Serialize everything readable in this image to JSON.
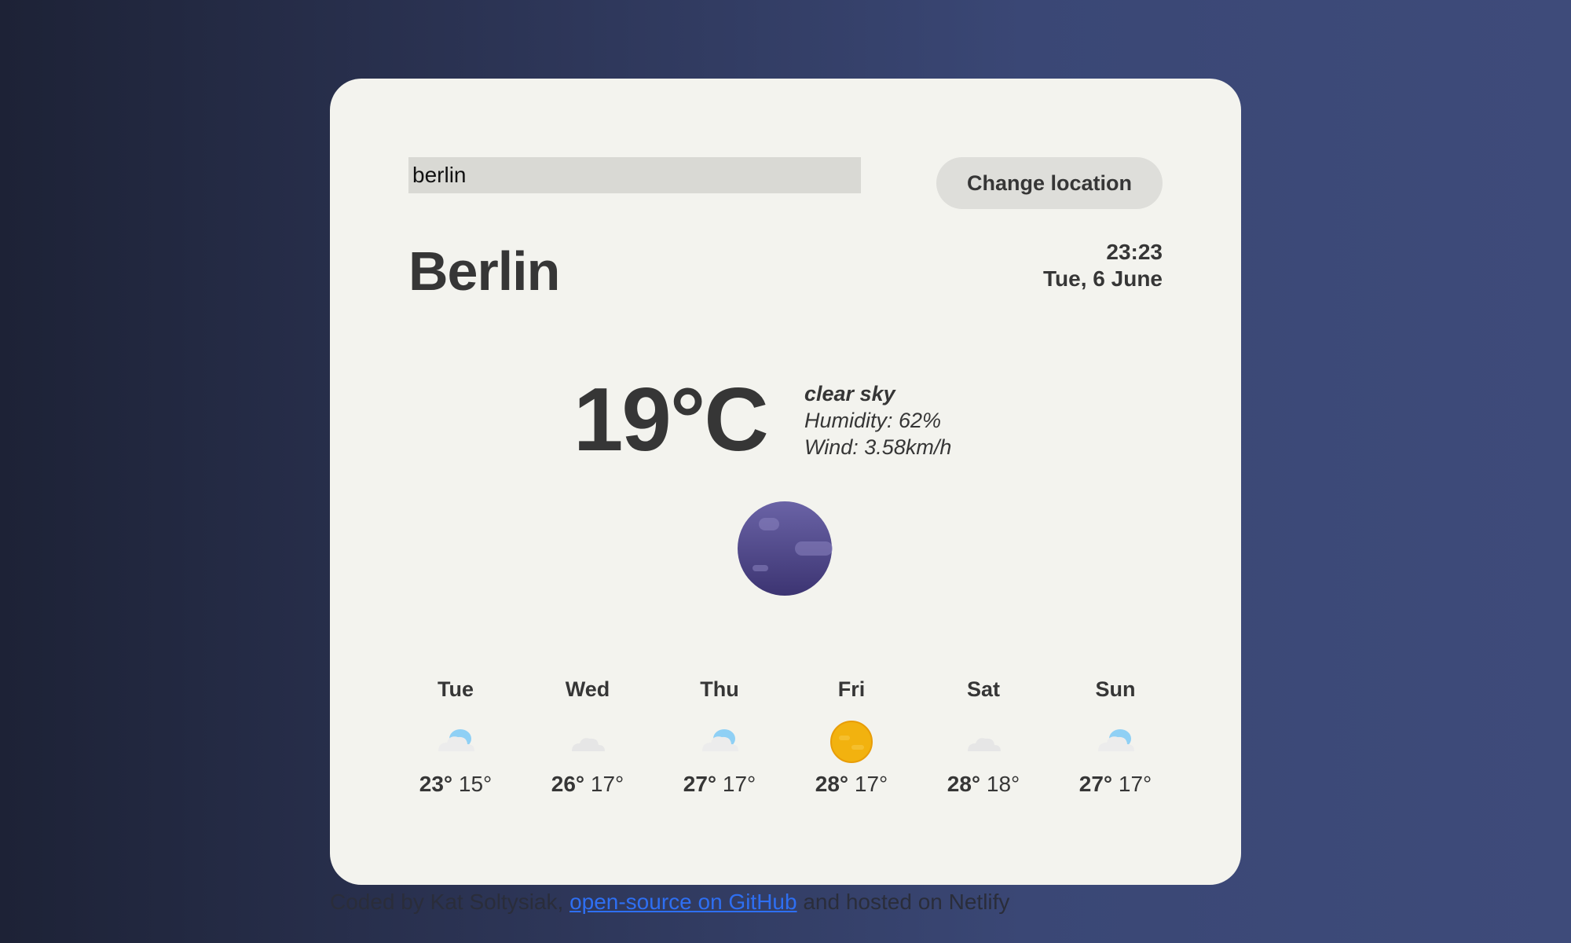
{
  "search": {
    "value": "berlin"
  },
  "change_button": {
    "label": "Change location"
  },
  "location": {
    "city": "Berlin",
    "time": "23:23",
    "date": "Tue, 6 June"
  },
  "current": {
    "temperature": "19°C",
    "description": "clear sky",
    "humidity": "Humidity: 62%",
    "wind": "Wind: 3.58km/h",
    "icon": "moon-clear-night-icon"
  },
  "forecast": [
    {
      "day": "Tue",
      "max": "23°",
      "min": "15°",
      "icon": "cloud-icon"
    },
    {
      "day": "Wed",
      "max": "26°",
      "min": "17°",
      "icon": "cloud-icon"
    },
    {
      "day": "Thu",
      "max": "27°",
      "min": "17°",
      "icon": "cloud-icon"
    },
    {
      "day": "Fri",
      "max": "28°",
      "min": "17°",
      "icon": "sun-icon"
    },
    {
      "day": "Sat",
      "max": "28°",
      "min": "18°",
      "icon": "cloud-icon"
    },
    {
      "day": "Sun",
      "max": "27°",
      "min": "17°",
      "icon": "cloud-icon"
    }
  ],
  "footer": {
    "prefix": "Coded by Kat Soltysiak,",
    "link": "open-source on GitHub",
    "suffix": "and hosted on Netlify"
  },
  "colors": {
    "card_background": "#f3f3ee",
    "text": "#363636",
    "link": "#2e6ff2",
    "moon": "#4e4888",
    "sun": "#f2b20f"
  }
}
